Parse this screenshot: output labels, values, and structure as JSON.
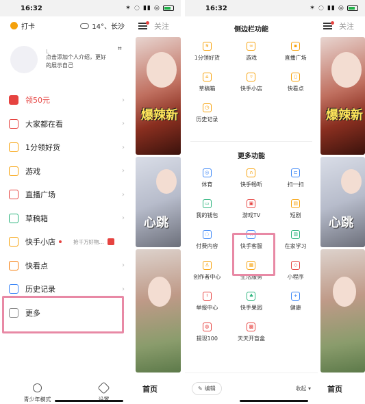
{
  "left": {
    "status": {
      "time": "16:32",
      "icons": "✶ ◌ ▮▮ ◎"
    },
    "checkin_label": "打卡",
    "weather": "14°、长沙",
    "profile": {
      "name": "L",
      "intro": "点击添加个人介绍，更好的展示自己"
    },
    "menu": [
      {
        "label": "领50元",
        "icon": "envelope-icon",
        "color": "#e64340",
        "red": true
      },
      {
        "label": "大家都在看",
        "icon": "eye-icon",
        "color": "#e64340"
      },
      {
        "label": "1分领好货",
        "icon": "gift-icon",
        "color": "#f7a20b"
      },
      {
        "label": "游戏",
        "icon": "gamepad-icon",
        "color": "#f7a20b"
      },
      {
        "label": "直播广场",
        "icon": "live-icon",
        "color": "#e64340"
      },
      {
        "label": "草稿箱",
        "icon": "folder-icon",
        "color": "#29b37b"
      },
      {
        "label": "快手小店",
        "icon": "cart-icon",
        "color": "#f7a20b",
        "promo": "抢千万好物..."
      },
      {
        "label": "快看点",
        "icon": "book-icon",
        "color": "#f77d0b"
      },
      {
        "label": "历史记录",
        "icon": "clock-icon",
        "color": "#3b86f7"
      },
      {
        "label": "更多",
        "icon": "grid-icon",
        "color": "#888888"
      }
    ],
    "bottom": {
      "teen_mode": "青少年模式",
      "settings": "设置"
    },
    "feed": {
      "follow": "关注",
      "home": "首页",
      "overlay1": "爆辣新",
      "overlay2": "心跳"
    }
  },
  "right": {
    "status": {
      "time": "16:32",
      "icons": "✶ ◌ ▮▮ ◎"
    },
    "sidebar_title": "侧边栏功能",
    "sidebar_items": [
      {
        "label": "1分领好货",
        "glyph": "¥"
      },
      {
        "label": "游戏",
        "glyph": "∞"
      },
      {
        "label": "直播广场",
        "glyph": "▪"
      },
      {
        "label": "草稿箱",
        "glyph": "⌂"
      },
      {
        "label": "快手小店",
        "glyph": "▿"
      },
      {
        "label": "快看点",
        "glyph": "▯"
      },
      {
        "label": "历史记录",
        "glyph": "◷"
      }
    ],
    "more_title": "更多功能",
    "more_items": [
      {
        "label": "体育",
        "glyph": "◎",
        "color": "#3b86f7"
      },
      {
        "label": "快手畅听",
        "glyph": "∩",
        "color": "#f7a20b"
      },
      {
        "label": "扫一扫",
        "glyph": "⊏",
        "color": "#3b86f7"
      },
      {
        "label": "我的钱包",
        "glyph": "▭",
        "color": "#29b37b"
      },
      {
        "label": "游戏TV",
        "glyph": "▣",
        "color": "#e64340"
      },
      {
        "label": "短剧",
        "glyph": "▤",
        "color": "#f7a20b"
      },
      {
        "label": "付费内容",
        "glyph": "◌",
        "color": "#3b86f7"
      },
      {
        "label": "快手客服",
        "glyph": "∩",
        "color": "#3b86f7"
      },
      {
        "label": "在家学习",
        "glyph": "▥",
        "color": "#29b37b"
      },
      {
        "label": "创作者中心",
        "glyph": "♙",
        "color": "#f7a20b"
      },
      {
        "label": "生活服务",
        "glyph": "▦",
        "color": "#f7a20b"
      },
      {
        "label": "小程序",
        "glyph": "◇",
        "color": "#e64340"
      },
      {
        "label": "举报中心",
        "glyph": "!",
        "color": "#e64340"
      },
      {
        "label": "快手果园",
        "glyph": "♣",
        "color": "#29b37b"
      },
      {
        "label": "健康",
        "glyph": "+",
        "color": "#3b86f7"
      },
      {
        "label": "提现100",
        "glyph": "◍",
        "color": "#e64340"
      },
      {
        "label": "天天开盲盒",
        "glyph": "▩",
        "color": "#e64340"
      }
    ],
    "edit_label": "编辑",
    "collapse_label": "收起",
    "feed": {
      "follow": "关注",
      "home": "首页",
      "overlay1": "爆辣新",
      "overlay2": "心跳"
    }
  }
}
